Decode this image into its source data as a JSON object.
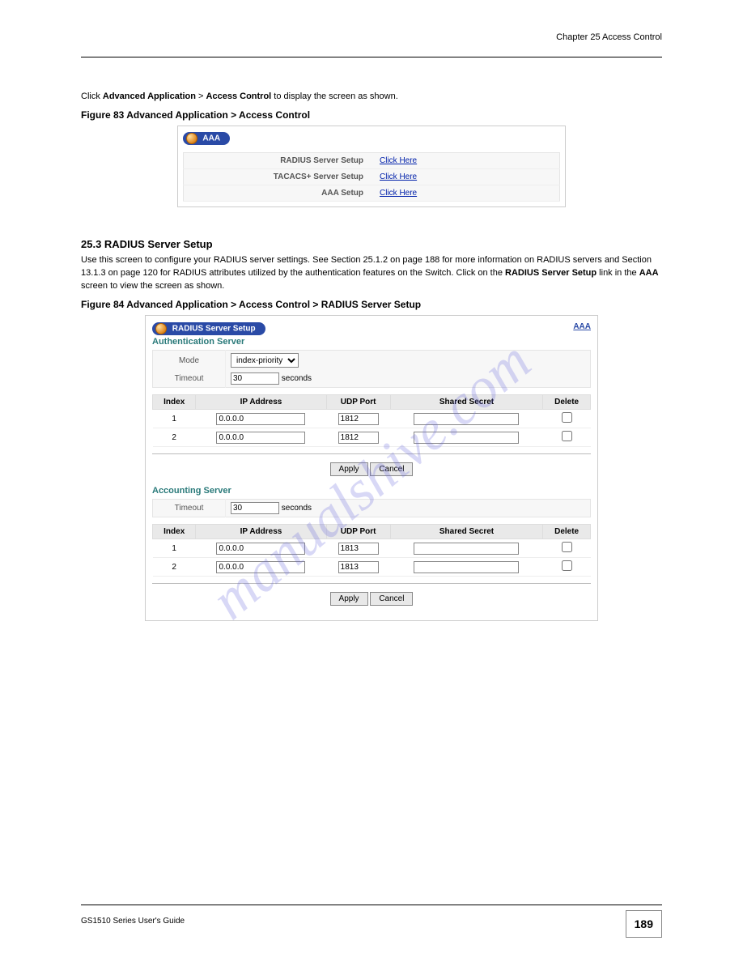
{
  "header": {
    "chapter": "Chapter 25 Access Control"
  },
  "intro": {
    "p1": "Click Advanced Application > Access Control to display the screen as shown."
  },
  "figure1": {
    "caption": "Figure 83   Advanced Application > Access Control",
    "title": "AAA",
    "rows": [
      {
        "label": "RADIUS Server Setup",
        "action": "Click Here"
      },
      {
        "label": "TACACS+ Server Setup",
        "action": "Click Here"
      },
      {
        "label": "AAA Setup",
        "action": "Click Here"
      }
    ]
  },
  "section2": {
    "heading": "25.3  RADIUS Server Setup",
    "p1": "Use this screen to configure your RADIUS server settings. See Section 25.1.2 on page 188 for more information on RADIUS servers and Section 13.1.3 on page 120 for RADIUS attributes utilized by the authentication features on the Switch. Click on the RADIUS Server Setup link in the AAA screen to view the screen as shown.",
    "caption": "Figure 84   Advanced Application > Access Control > RADIUS Server Setup"
  },
  "radius": {
    "title": "RADIUS Server Setup",
    "crumb": "AAA",
    "auth": {
      "title": "Authentication Server",
      "mode_label": "Mode",
      "mode_value": "index-priority",
      "timeout_label": "Timeout",
      "timeout_value": "30",
      "timeout_unit": "seconds",
      "cols": {
        "index": "Index",
        "ip": "IP Address",
        "port": "UDP Port",
        "secret": "Shared Secret",
        "del": "Delete"
      },
      "rows": [
        {
          "index": "1",
          "ip": "0.0.0.0",
          "port": "1812",
          "secret": ""
        },
        {
          "index": "2",
          "ip": "0.0.0.0",
          "port": "1812",
          "secret": ""
        }
      ],
      "apply": "Apply",
      "cancel": "Cancel"
    },
    "acct": {
      "title": "Accounting Server",
      "timeout_label": "Timeout",
      "timeout_value": "30",
      "timeout_unit": "seconds",
      "cols": {
        "index": "Index",
        "ip": "IP Address",
        "port": "UDP Port",
        "secret": "Shared Secret",
        "del": "Delete"
      },
      "rows": [
        {
          "index": "1",
          "ip": "0.0.0.0",
          "port": "1813",
          "secret": ""
        },
        {
          "index": "2",
          "ip": "0.0.0.0",
          "port": "1813",
          "secret": ""
        }
      ],
      "apply": "Apply",
      "cancel": "Cancel"
    }
  },
  "footer": {
    "guide": "GS1510 Series User's Guide",
    "pagenum": "189"
  },
  "watermark": "manualshive.com"
}
